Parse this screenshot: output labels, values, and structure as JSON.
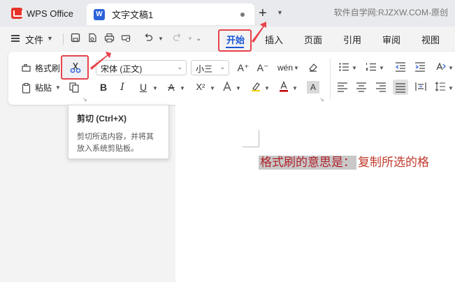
{
  "titlebar": {
    "app_name": "WPS Office",
    "doc_title": "文字文稿1",
    "new_tab": "+",
    "watermark": "软件自学网:RJZXW.COM-原创"
  },
  "menu": {
    "file": "文件",
    "tabs": [
      "开始",
      "插入",
      "页面",
      "引用",
      "审阅",
      "视图"
    ],
    "active_tab": "开始"
  },
  "ribbon": {
    "format_painter": "格式刷",
    "paste": "粘贴",
    "font_name": "宋体 (正文)",
    "font_size": "小三",
    "bold": "B",
    "italic": "I",
    "underline": "U",
    "strikethrough": "A",
    "superscript": "X²",
    "char_shading": "A",
    "pinyin": "wén",
    "grow_font": "A⁺",
    "shrink_font": "A⁻"
  },
  "tooltip": {
    "title": "剪切 (Ctrl+X)",
    "desc_line1": "剪切所选内容，并将其",
    "desc_line2": "放入系统剪贴板。"
  },
  "document": {
    "selected_text": "格式刷的意思是：",
    "rest_text": "复制所选的格"
  },
  "colors": {
    "accent_blue": "#1a56d6",
    "highlight_red": "#e8434b",
    "doc_text_red": "#c0392b",
    "selection_gray": "#c8c8c8"
  }
}
